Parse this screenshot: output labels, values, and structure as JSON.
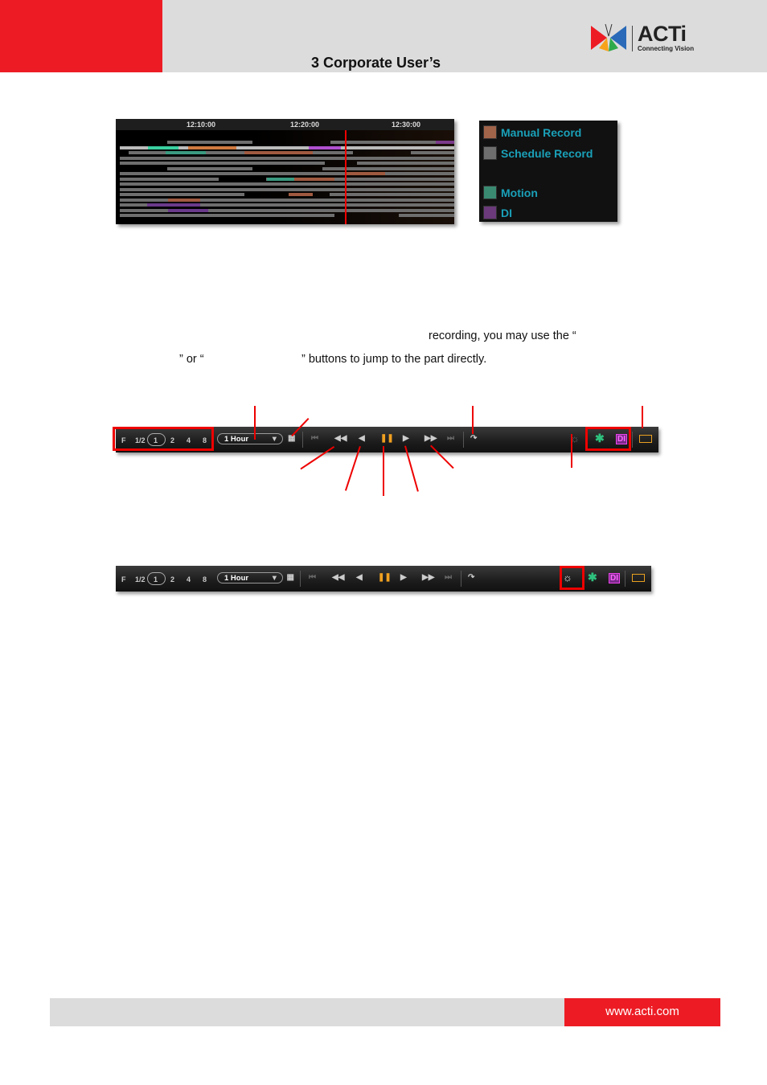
{
  "header": {
    "title": "3 Corporate User’s",
    "logo_text": "ACTi",
    "logo_sub": "Connecting Vision"
  },
  "timeline": {
    "ticks": [
      "12:10:00",
      "12:20:00",
      "12:30:00"
    ]
  },
  "legend": [
    {
      "label": "Manual Record",
      "color": "#a0644a"
    },
    {
      "label": "Schedule Record",
      "color": "#6e6e6e"
    },
    {
      "label": "Motion",
      "color": "#3a8a72"
    },
    {
      "label": "DI",
      "color": "#6a3a7a"
    }
  ],
  "text": {
    "line1": "recording, you may use the “",
    "line2a": "” or “",
    "line2b": "” buttons to jump to the part directly."
  },
  "toolbar": {
    "speeds": [
      "F",
      "1/2",
      "1",
      "2",
      "4",
      "8"
    ],
    "range": "1 Hour",
    "di_label": "DI"
  },
  "footer": {
    "url": "www.acti.com"
  }
}
